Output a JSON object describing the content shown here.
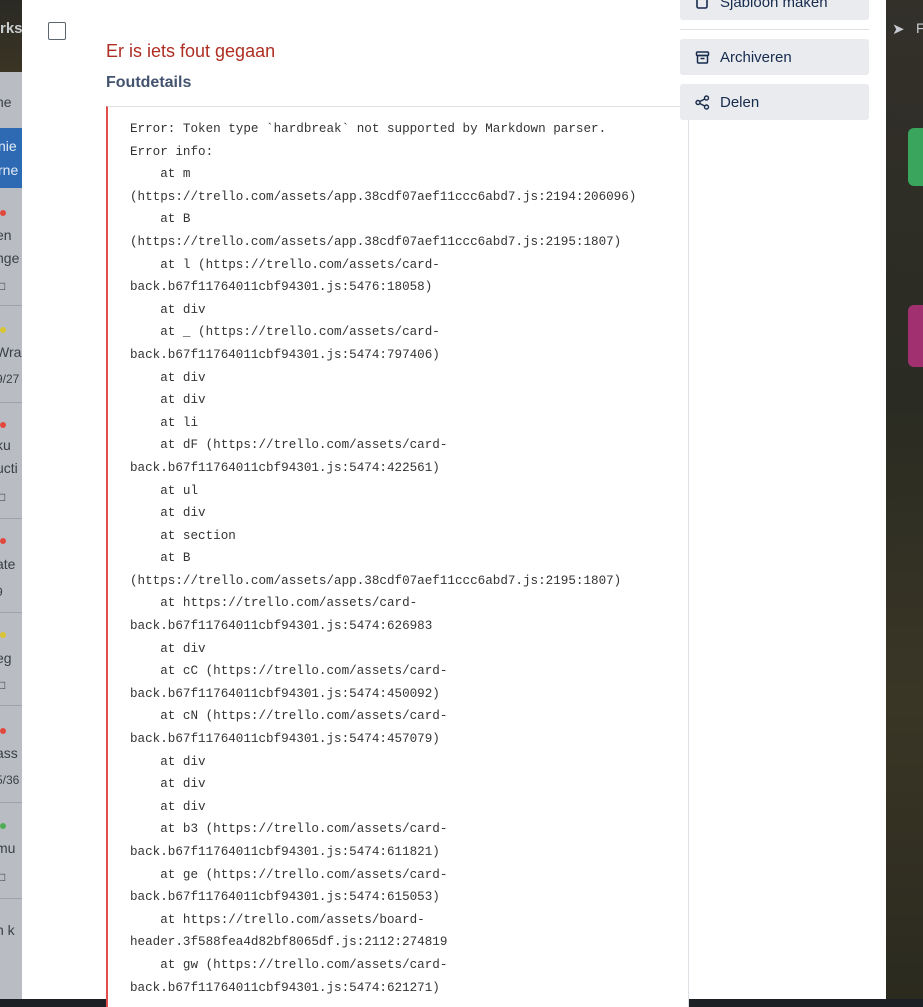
{
  "modal": {
    "error_title": "Er is iets fout gegaan",
    "details_title": "Foutdetails",
    "error_lines": [
      "Error: Token type `hardbreak` not supported by Markdown parser.",
      "Error info:",
      "    at m",
      "(https://trello.com/assets/app.38cdf07aef11ccc6abd7.js:2194:206096)",
      "    at B",
      "(https://trello.com/assets/app.38cdf07aef11ccc6abd7.js:2195:1807)",
      "    at l (https://trello.com/assets/card-",
      "back.b67f11764011cbf94301.js:5476:18058)",
      "    at div",
      "    at _ (https://trello.com/assets/card-",
      "back.b67f11764011cbf94301.js:5474:797406)",
      "    at div",
      "    at div",
      "    at li",
      "    at dF (https://trello.com/assets/card-",
      "back.b67f11764011cbf94301.js:5474:422561)",
      "    at ul",
      "    at div",
      "    at section",
      "    at B",
      "(https://trello.com/assets/app.38cdf07aef11ccc6abd7.js:2195:1807)",
      "    at https://trello.com/assets/card-",
      "back.b67f11764011cbf94301.js:5474:626983",
      "    at div",
      "    at cC (https://trello.com/assets/card-",
      "back.b67f11764011cbf94301.js:5474:450092)",
      "    at cN (https://trello.com/assets/card-",
      "back.b67f11764011cbf94301.js:5474:457079)",
      "    at div",
      "    at div",
      "    at div",
      "    at b3 (https://trello.com/assets/card-",
      "back.b67f11764011cbf94301.js:5474:611821)",
      "    at ge (https://trello.com/assets/card-",
      "back.b67f11764011cbf94301.js:5474:615053)",
      "    at https://trello.com/assets/board-",
      "header.3f588fea4d82bf8065df.js:2112:274819",
      "    at gw (https://trello.com/assets/card-",
      "back.b67f11764011cbf94301.js:5474:621271)"
    ]
  },
  "sidebar": {
    "template_label": "Sjabloon maken",
    "archive_label": "Archiveren",
    "share_label": "Delen"
  },
  "background": {
    "top_word": "rks",
    "right_letter": "F",
    "list_fragments": [
      "ne",
      "en",
      "nge",
      "Wra",
      "9/27",
      "ku",
      "ucti",
      "ate",
      "9",
      "eg",
      "ass",
      "5/36",
      "mu",
      "n k"
    ],
    "list_header": [
      "nie",
      "rne"
    ]
  },
  "colors": {
    "error_red": "#ae2e24",
    "border_red": "#e04d4d",
    "button_bg": "#e9ebee",
    "text_dark": "#172b4d"
  }
}
